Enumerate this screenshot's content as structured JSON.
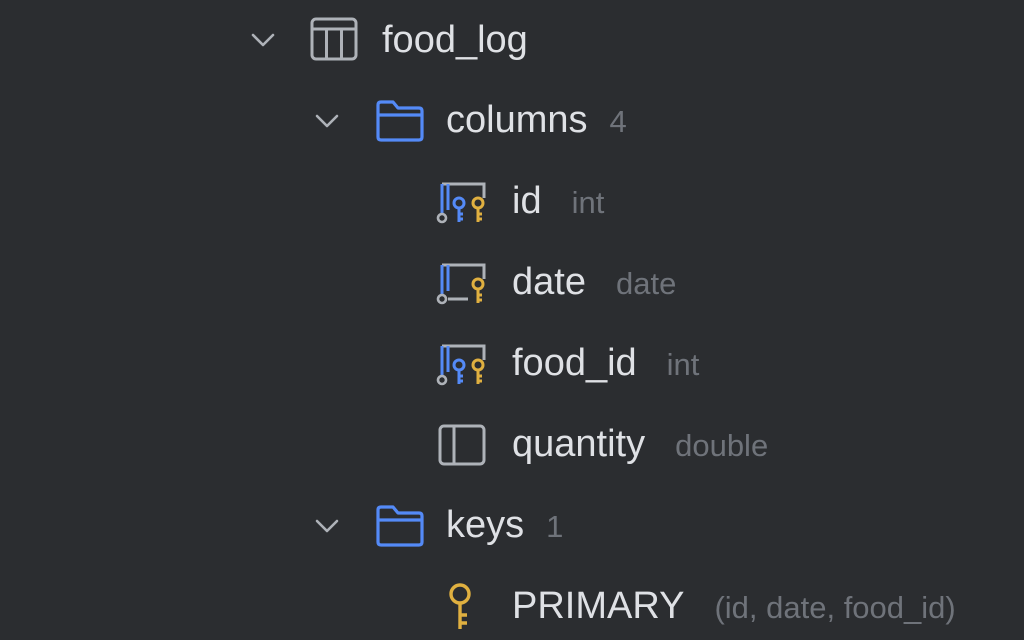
{
  "tree": {
    "table": {
      "name": "food_log",
      "icon": "table-icon",
      "expanded": true
    },
    "columns_folder": {
      "label": "columns",
      "count": "4",
      "icon": "folder-icon",
      "expanded": true
    },
    "columns": [
      {
        "name": "id",
        "type": "int",
        "icon": "primary-foreign-key-column-icon"
      },
      {
        "name": "date",
        "type": "date",
        "icon": "primary-key-column-icon"
      },
      {
        "name": "food_id",
        "type": "int",
        "icon": "primary-foreign-key-column-icon"
      },
      {
        "name": "quantity",
        "type": "double",
        "icon": "column-icon"
      }
    ],
    "keys_folder": {
      "label": "keys",
      "count": "1",
      "icon": "folder-icon",
      "expanded": true
    },
    "keys": [
      {
        "name": "PRIMARY",
        "columns": "(id, date, food_id)",
        "icon": "key-icon"
      }
    ]
  },
  "colors": {
    "background": "#2b2d30",
    "text": "#dfe1e5",
    "muted_text": "#6f737a",
    "folder_blue": "#548af7",
    "key_gold": "#e0b040",
    "icon_gray": "#aeb2b8"
  }
}
